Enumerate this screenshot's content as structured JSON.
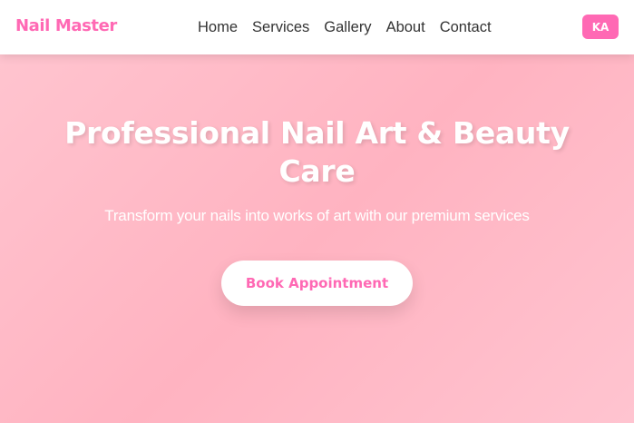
{
  "header": {
    "brand": "Nail Master",
    "nav": [
      "Home",
      "Services",
      "Gallery",
      "About",
      "Contact"
    ],
    "avatar_initials": "KA"
  },
  "hero": {
    "title": "Professional Nail Art & Beauty Care",
    "subtitle": "Transform your nails into works of art with our premium services",
    "cta_label": "Book Appointment"
  },
  "colors": {
    "accent": "#ff69b4",
    "hero_background": "#ffb6c1",
    "nav_text": "#333333"
  }
}
